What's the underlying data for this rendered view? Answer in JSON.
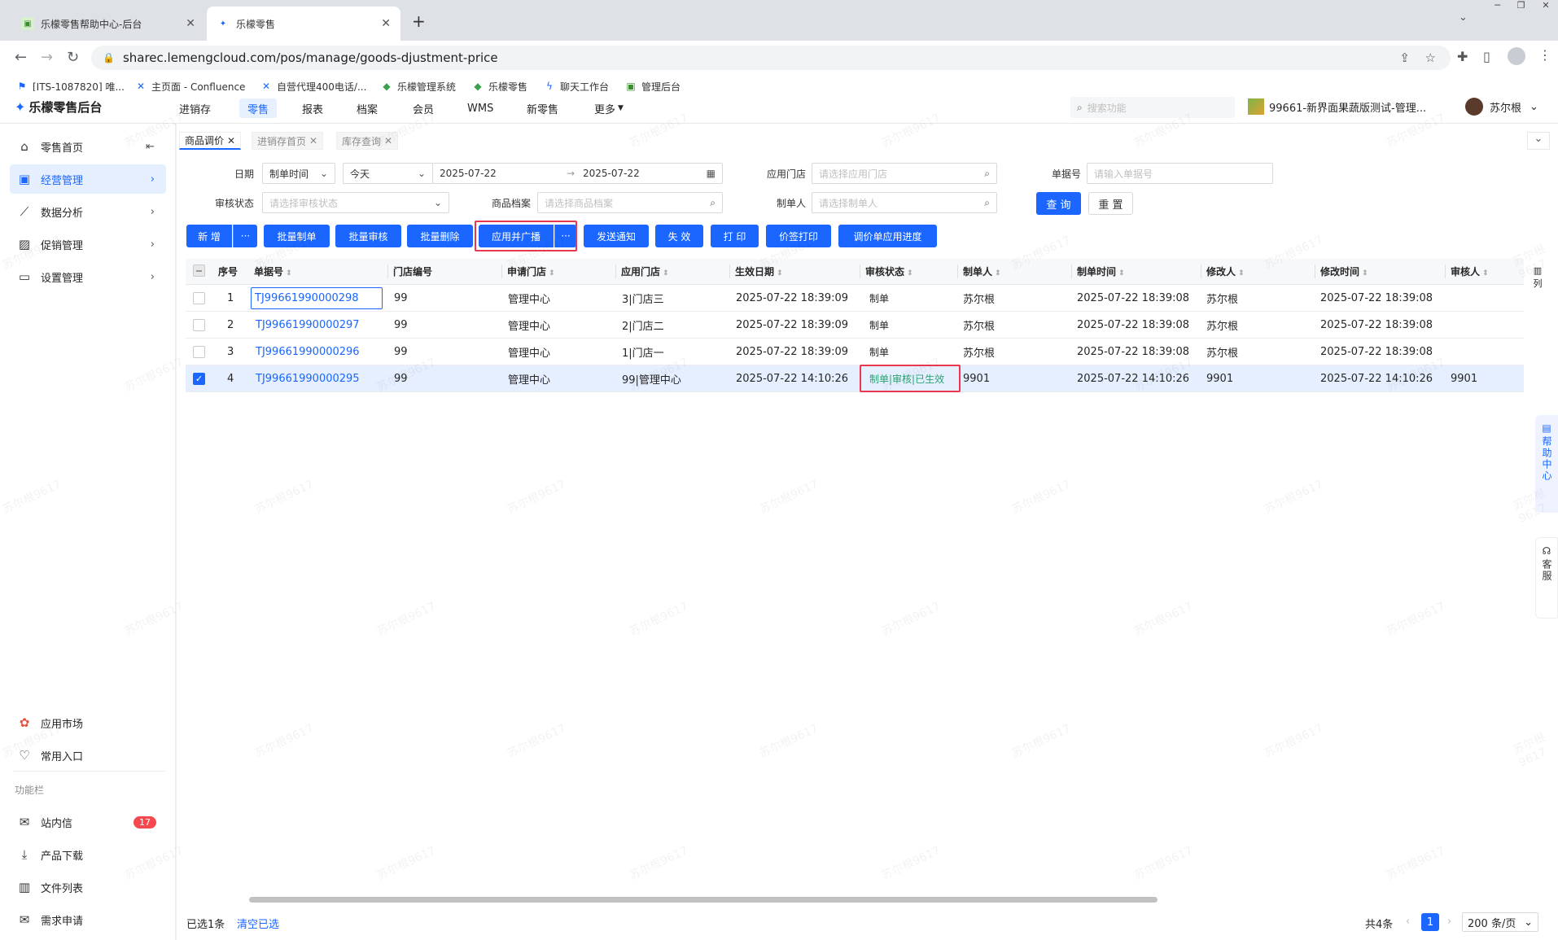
{
  "browser": {
    "tabs": [
      {
        "title": "乐檬零售帮助中心-后台"
      },
      {
        "title": "乐檬零售"
      }
    ],
    "new_tab": "+",
    "url": "sharec.lemengcloud.com/pos/manage/goods-djustment-price",
    "bookmarks": [
      "[ITS-1087820] 唯...",
      "主页面 - Confluence",
      "自营代理400电话/...",
      "乐檬管理系统",
      "乐檬零售",
      "聊天工作台",
      "管理后台"
    ]
  },
  "app": {
    "logo": "乐檬零售后台",
    "menus": [
      "进销存",
      "零售",
      "报表",
      "档案",
      "会员",
      "WMS",
      "新零售",
      "更多"
    ],
    "search_placeholder": "搜索功能",
    "store": "99661-新界面果蔬版测试-管理...",
    "user": "苏尔根"
  },
  "sidebar": {
    "items": [
      {
        "label": "零售首页"
      },
      {
        "label": "经营管理"
      },
      {
        "label": "数据分析"
      },
      {
        "label": "促销管理"
      },
      {
        "label": "设置管理"
      }
    ],
    "bottom": [
      {
        "label": "应用市场"
      },
      {
        "label": "常用入口"
      }
    ],
    "section": "功能栏",
    "tools": [
      {
        "label": "站内信",
        "badge": "17"
      },
      {
        "label": "产品下载"
      },
      {
        "label": "文件列表"
      },
      {
        "label": "需求申请"
      }
    ]
  },
  "page_tabs": [
    "商品调价",
    "进销存首页",
    "库存查询"
  ],
  "filters": {
    "date_label": "日期",
    "date_type": "制单时间",
    "date_range": "今天",
    "date_start": "2025-07-22",
    "date_end": "2025-07-22",
    "store_label": "应用门店",
    "store_placeholder": "请选择应用门店",
    "no_label": "单据号",
    "no_placeholder": "请输入单据号",
    "status_label": "审核状态",
    "status_placeholder": "请选择审核状态",
    "goods_label": "商品档案",
    "goods_placeholder": "请选择商品档案",
    "maker_label": "制单人",
    "maker_placeholder": "请选择制单人",
    "query": "查 询",
    "reset": "重 置"
  },
  "actions": {
    "add": "新 增",
    "more": "···",
    "batch_make": "批量制单",
    "batch_audit": "批量审核",
    "batch_delete": "批量删除",
    "apply_broadcast": "应用并广播",
    "send_notice": "发送通知",
    "invalidate": "失 效",
    "print": "打 印",
    "price_tag_print": "价签打印",
    "progress": "调价单应用进度"
  },
  "table": {
    "columns": [
      "序号",
      "单据号",
      "门店编号",
      "申请门店",
      "应用门店",
      "生效日期",
      "审核状态",
      "制单人",
      "制单时间",
      "修改人",
      "修改时间",
      "审核人"
    ],
    "col_settings": "列",
    "rows": [
      {
        "idx": "1",
        "no": "TJ99661990000298",
        "store_code": "99",
        "apply_store": "管理中心",
        "target_store": "3|门店三",
        "effective": "2025-07-22 18:39:09",
        "status": "制单",
        "maker": "苏尔根",
        "make_time": "2025-07-22 18:39:08",
        "modifier": "苏尔根",
        "modify_time": "2025-07-22 18:39:08",
        "auditor": "",
        "checked": false
      },
      {
        "idx": "2",
        "no": "TJ99661990000297",
        "store_code": "99",
        "apply_store": "管理中心",
        "target_store": "2|门店二",
        "effective": "2025-07-22 18:39:09",
        "status": "制单",
        "maker": "苏尔根",
        "make_time": "2025-07-22 18:39:08",
        "modifier": "苏尔根",
        "modify_time": "2025-07-22 18:39:08",
        "auditor": "",
        "checked": false
      },
      {
        "idx": "3",
        "no": "TJ99661990000296",
        "store_code": "99",
        "apply_store": "管理中心",
        "target_store": "1|门店一",
        "effective": "2025-07-22 18:39:09",
        "status": "制单",
        "maker": "苏尔根",
        "make_time": "2025-07-22 18:39:08",
        "modifier": "苏尔根",
        "modify_time": "2025-07-22 18:39:08",
        "auditor": "",
        "checked": false
      },
      {
        "idx": "4",
        "no": "TJ99661990000295",
        "store_code": "99",
        "apply_store": "管理中心",
        "target_store": "99|管理中心",
        "effective": "2025-07-22 14:10:26",
        "status": "制单|审核|已生效",
        "maker": "9901",
        "make_time": "2025-07-22 14:10:26",
        "modifier": "9901",
        "modify_time": "2025-07-22 14:10:26",
        "auditor": "9901",
        "checked": true
      }
    ]
  },
  "footer": {
    "selected": "已选1条",
    "clear": "清空已选",
    "total": "共4条",
    "page": "1",
    "page_size": "200 条/页"
  },
  "dock": {
    "help": "帮助中心",
    "service": "客服"
  },
  "watermark": "苏尔根9617"
}
